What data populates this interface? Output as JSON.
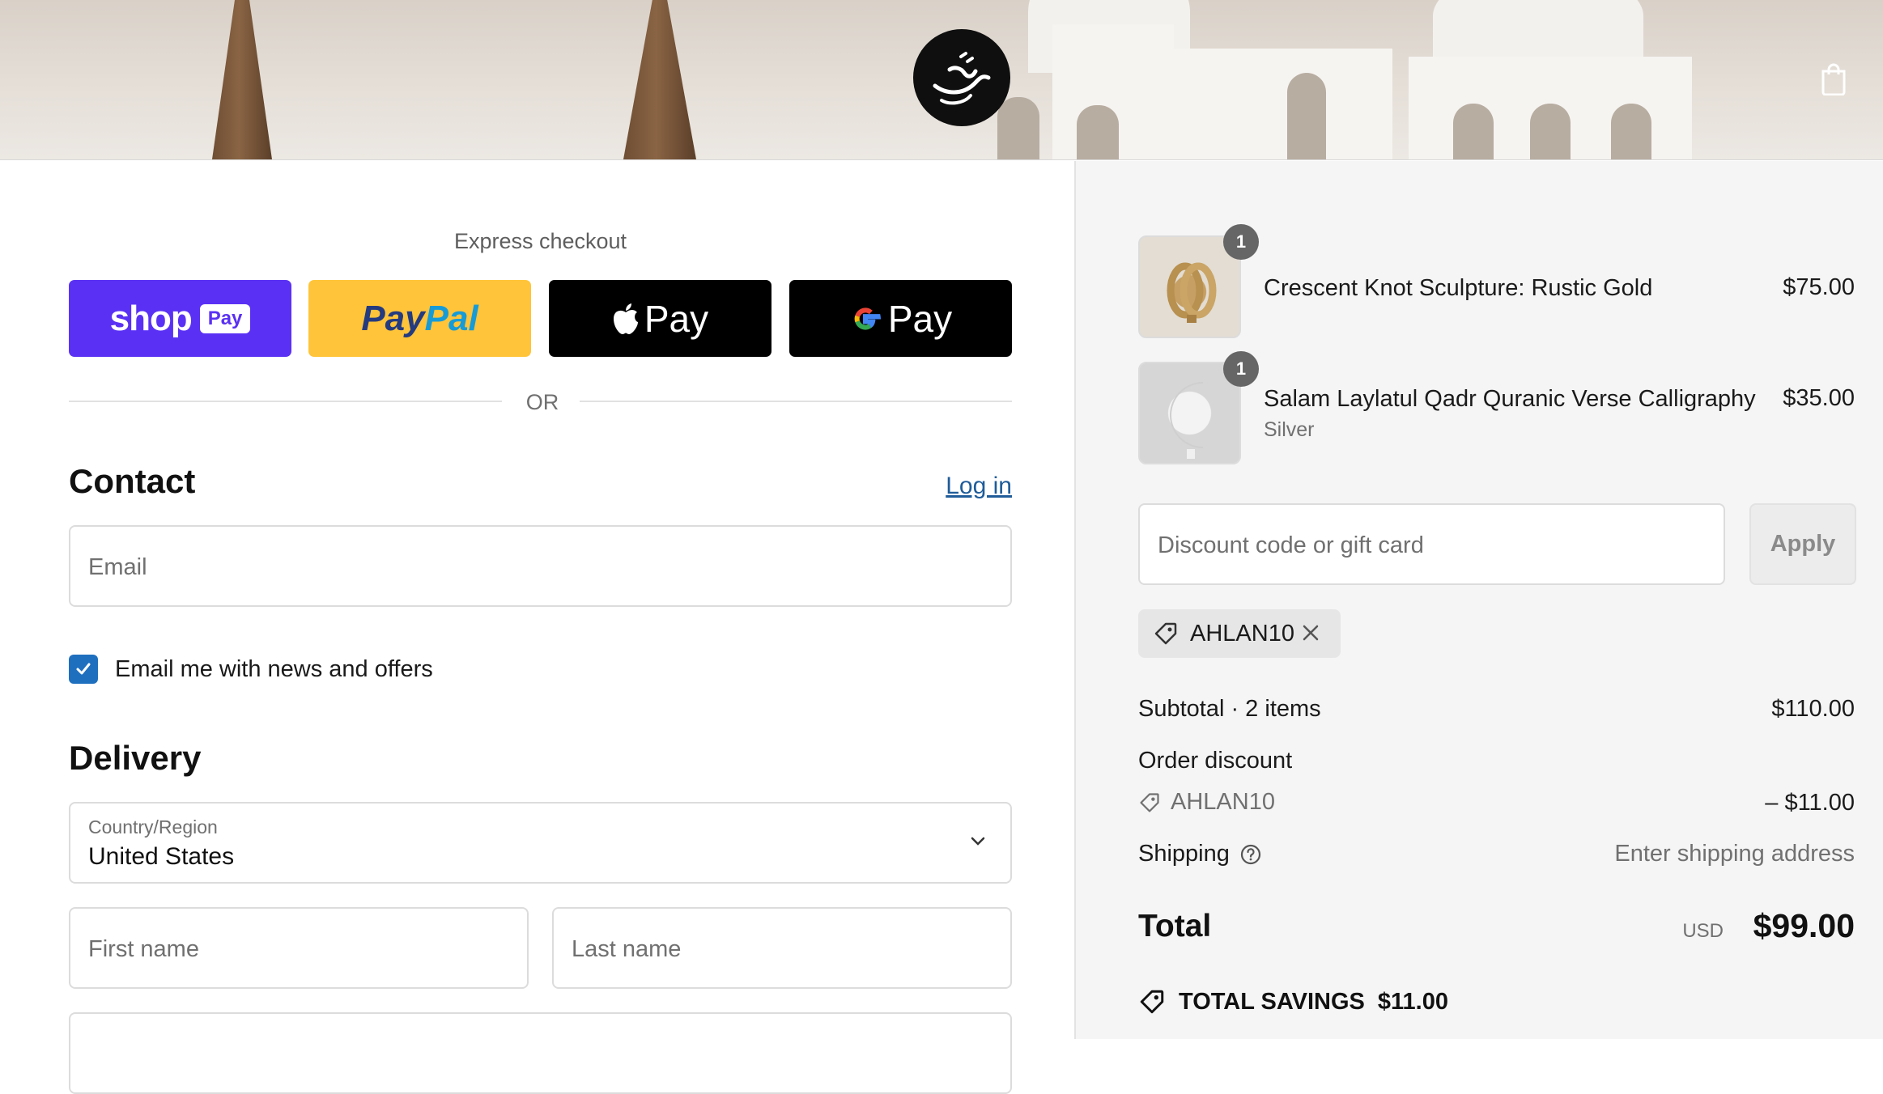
{
  "colors": {
    "shop_pay": "#5a31f4",
    "paypal": "#ffc439",
    "link": "#1f5c99",
    "checkbox": "#1f6fbf"
  },
  "express": {
    "title": "Express checkout",
    "buttons": [
      {
        "name": "shop",
        "text": "shop",
        "badge": "Pay"
      },
      {
        "name": "paypal",
        "text_a": "Pay",
        "text_b": "Pal"
      },
      {
        "name": "apple-pay",
        "text": "Pay"
      },
      {
        "name": "google-pay",
        "text": "Pay"
      }
    ],
    "divider": "OR"
  },
  "contact": {
    "heading": "Contact",
    "login": "Log in",
    "email_placeholder": "Email",
    "newsletter_label": "Email me with news and offers",
    "newsletter_checked": true
  },
  "delivery": {
    "heading": "Delivery",
    "country_label": "Country/Region",
    "country_value": "United States",
    "first_name_placeholder": "First name",
    "last_name_placeholder": "Last name"
  },
  "cart": {
    "items": [
      {
        "quantity": "1",
        "name": "Crescent Knot Sculpture: Rustic Gold",
        "variant": "",
        "price": "$75.00"
      },
      {
        "quantity": "1",
        "name": "Salam Laylatul Qadr Quranic Verse Calligraphy",
        "variant": "Silver",
        "price": "$35.00"
      }
    ],
    "discount_placeholder": "Discount code or gift card",
    "apply_label": "Apply",
    "applied_code": "AHLAN10",
    "subtotal_label": "Subtotal · 2 items",
    "subtotal_value": "$110.00",
    "order_discount_label": "Order discount",
    "order_discount_code": "AHLAN10",
    "order_discount_value": "– $11.00",
    "shipping_label": "Shipping",
    "shipping_value": "Enter shipping address",
    "total_label": "Total",
    "total_currency": "USD",
    "total_value": "$99.00",
    "savings_label": "TOTAL SAVINGS",
    "savings_value": "$11.00"
  }
}
